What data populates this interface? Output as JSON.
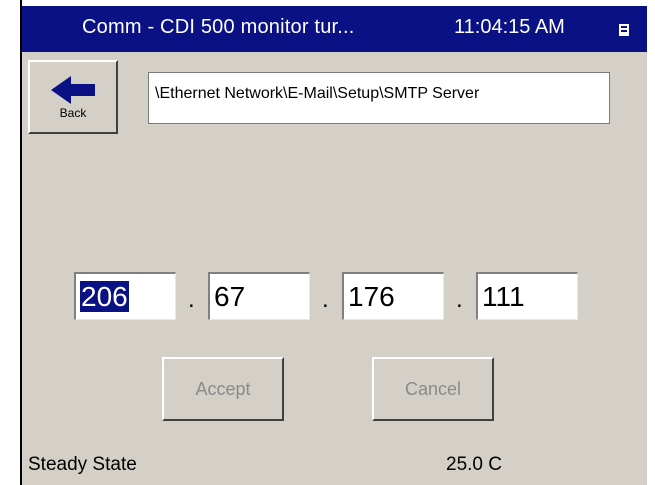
{
  "window": {
    "title": "Comm - CDI 500 monitor tur...",
    "time": "11:04:15 AM"
  },
  "back_button": {
    "label": "Back"
  },
  "path": {
    "value": "\\Ethernet Network\\E-Mail\\Setup\\SMTP Server"
  },
  "ip_address": {
    "octets": [
      "206",
      "67",
      "176",
      "111"
    ],
    "separator": "."
  },
  "buttons": {
    "accept": "Accept",
    "cancel": "Cancel"
  },
  "status_bar": {
    "state": "Steady State",
    "temperature": "25.0 C"
  },
  "colors": {
    "titlebar": "#0a1185",
    "background": "#d4d0c8",
    "selection": "#0a1185"
  }
}
